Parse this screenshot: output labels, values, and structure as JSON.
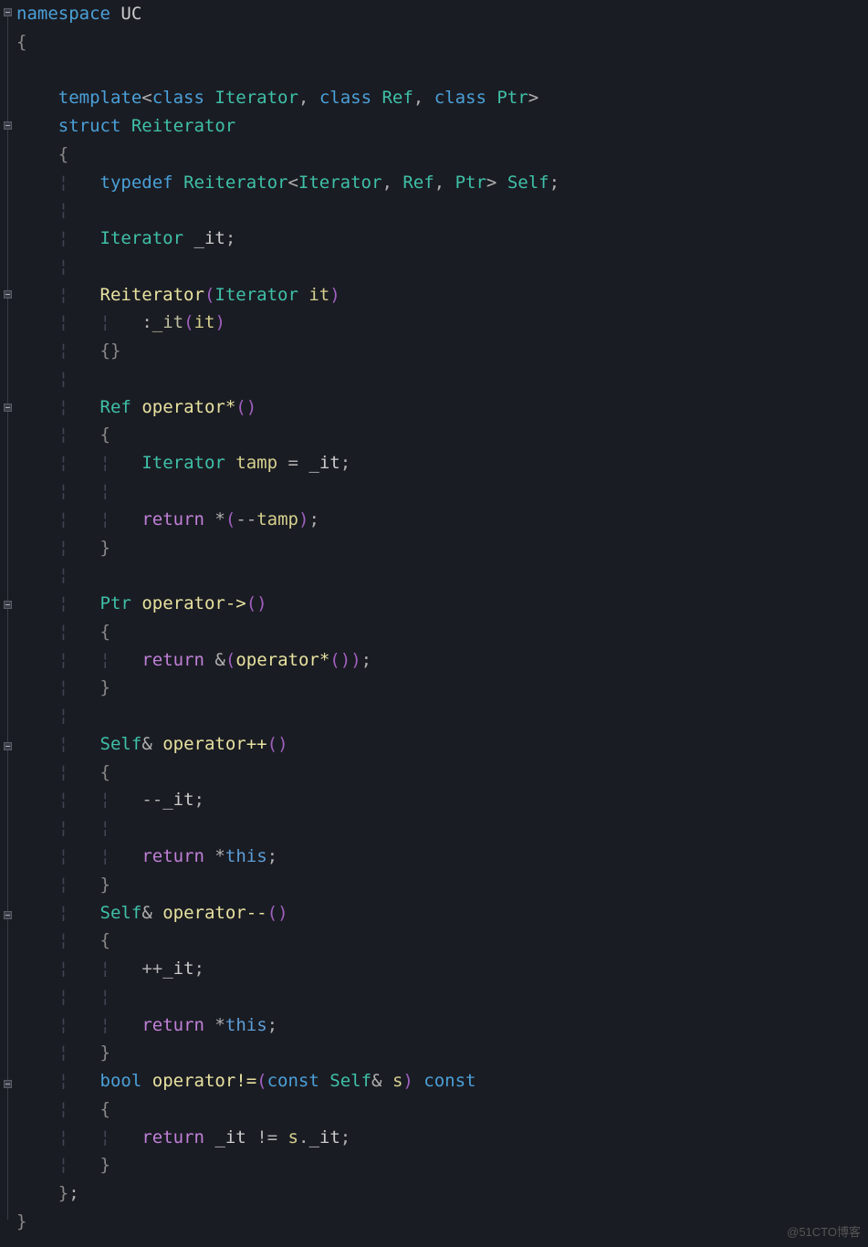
{
  "code": {
    "ns_kw": "namespace",
    "ns_name": "UC",
    "open_brace": "{",
    "close_brace": "}",
    "template_kw": "template",
    "class_kw": "class",
    "tpl_Iterator": "Iterator",
    "tpl_Ref": "Ref",
    "tpl_Ptr": "Ptr",
    "struct_kw": "struct",
    "struct_name": "Reiterator",
    "typedef_kw": "typedef",
    "self_name": "Self",
    "member_type": "Iterator",
    "member_name": "_it",
    "ctor_name": "Reiterator",
    "ctor_param_type": "Iterator",
    "ctor_param_name": "it",
    "ctor_init_member": "_it",
    "ctor_init_arg": "it",
    "ret_Ref": "Ref",
    "op_star": "operator*",
    "tamp_type": "Iterator",
    "tamp_name": "tamp",
    "tamp_rhs": "_it",
    "return_kw": "return",
    "deref_expr_pre": "*(--",
    "deref_expr_id": "tamp",
    "deref_expr_post": ")",
    "ret_Ptr": "Ptr",
    "op_arrow": "operator->",
    "arrow_body": "&(operator*())",
    "amp": "&",
    "ret_Self_ref": "Self",
    "op_pp": "operator++",
    "pp_body": "--_it",
    "this_kw": "this",
    "op_mm": "operator--",
    "mm_body": "++_it",
    "ret_bool": "bool",
    "op_ne": "operator!=",
    "ne_param_const": "const",
    "ne_param_type": "Self",
    "ne_param_name": "s",
    "ne_const": "const",
    "ne_lhs": "_it",
    "ne_op": "!=",
    "ne_rhs_obj": "s",
    "ne_rhs_mem": "_it",
    "semicolon": ";",
    "comma": ",",
    "lt": "<",
    "gt": ">",
    "lparen": "(",
    "rparen": ")",
    "colon": ":",
    "dot": ".",
    "eq": "=",
    "star": "*"
  },
  "watermark": "@51CTO博客"
}
